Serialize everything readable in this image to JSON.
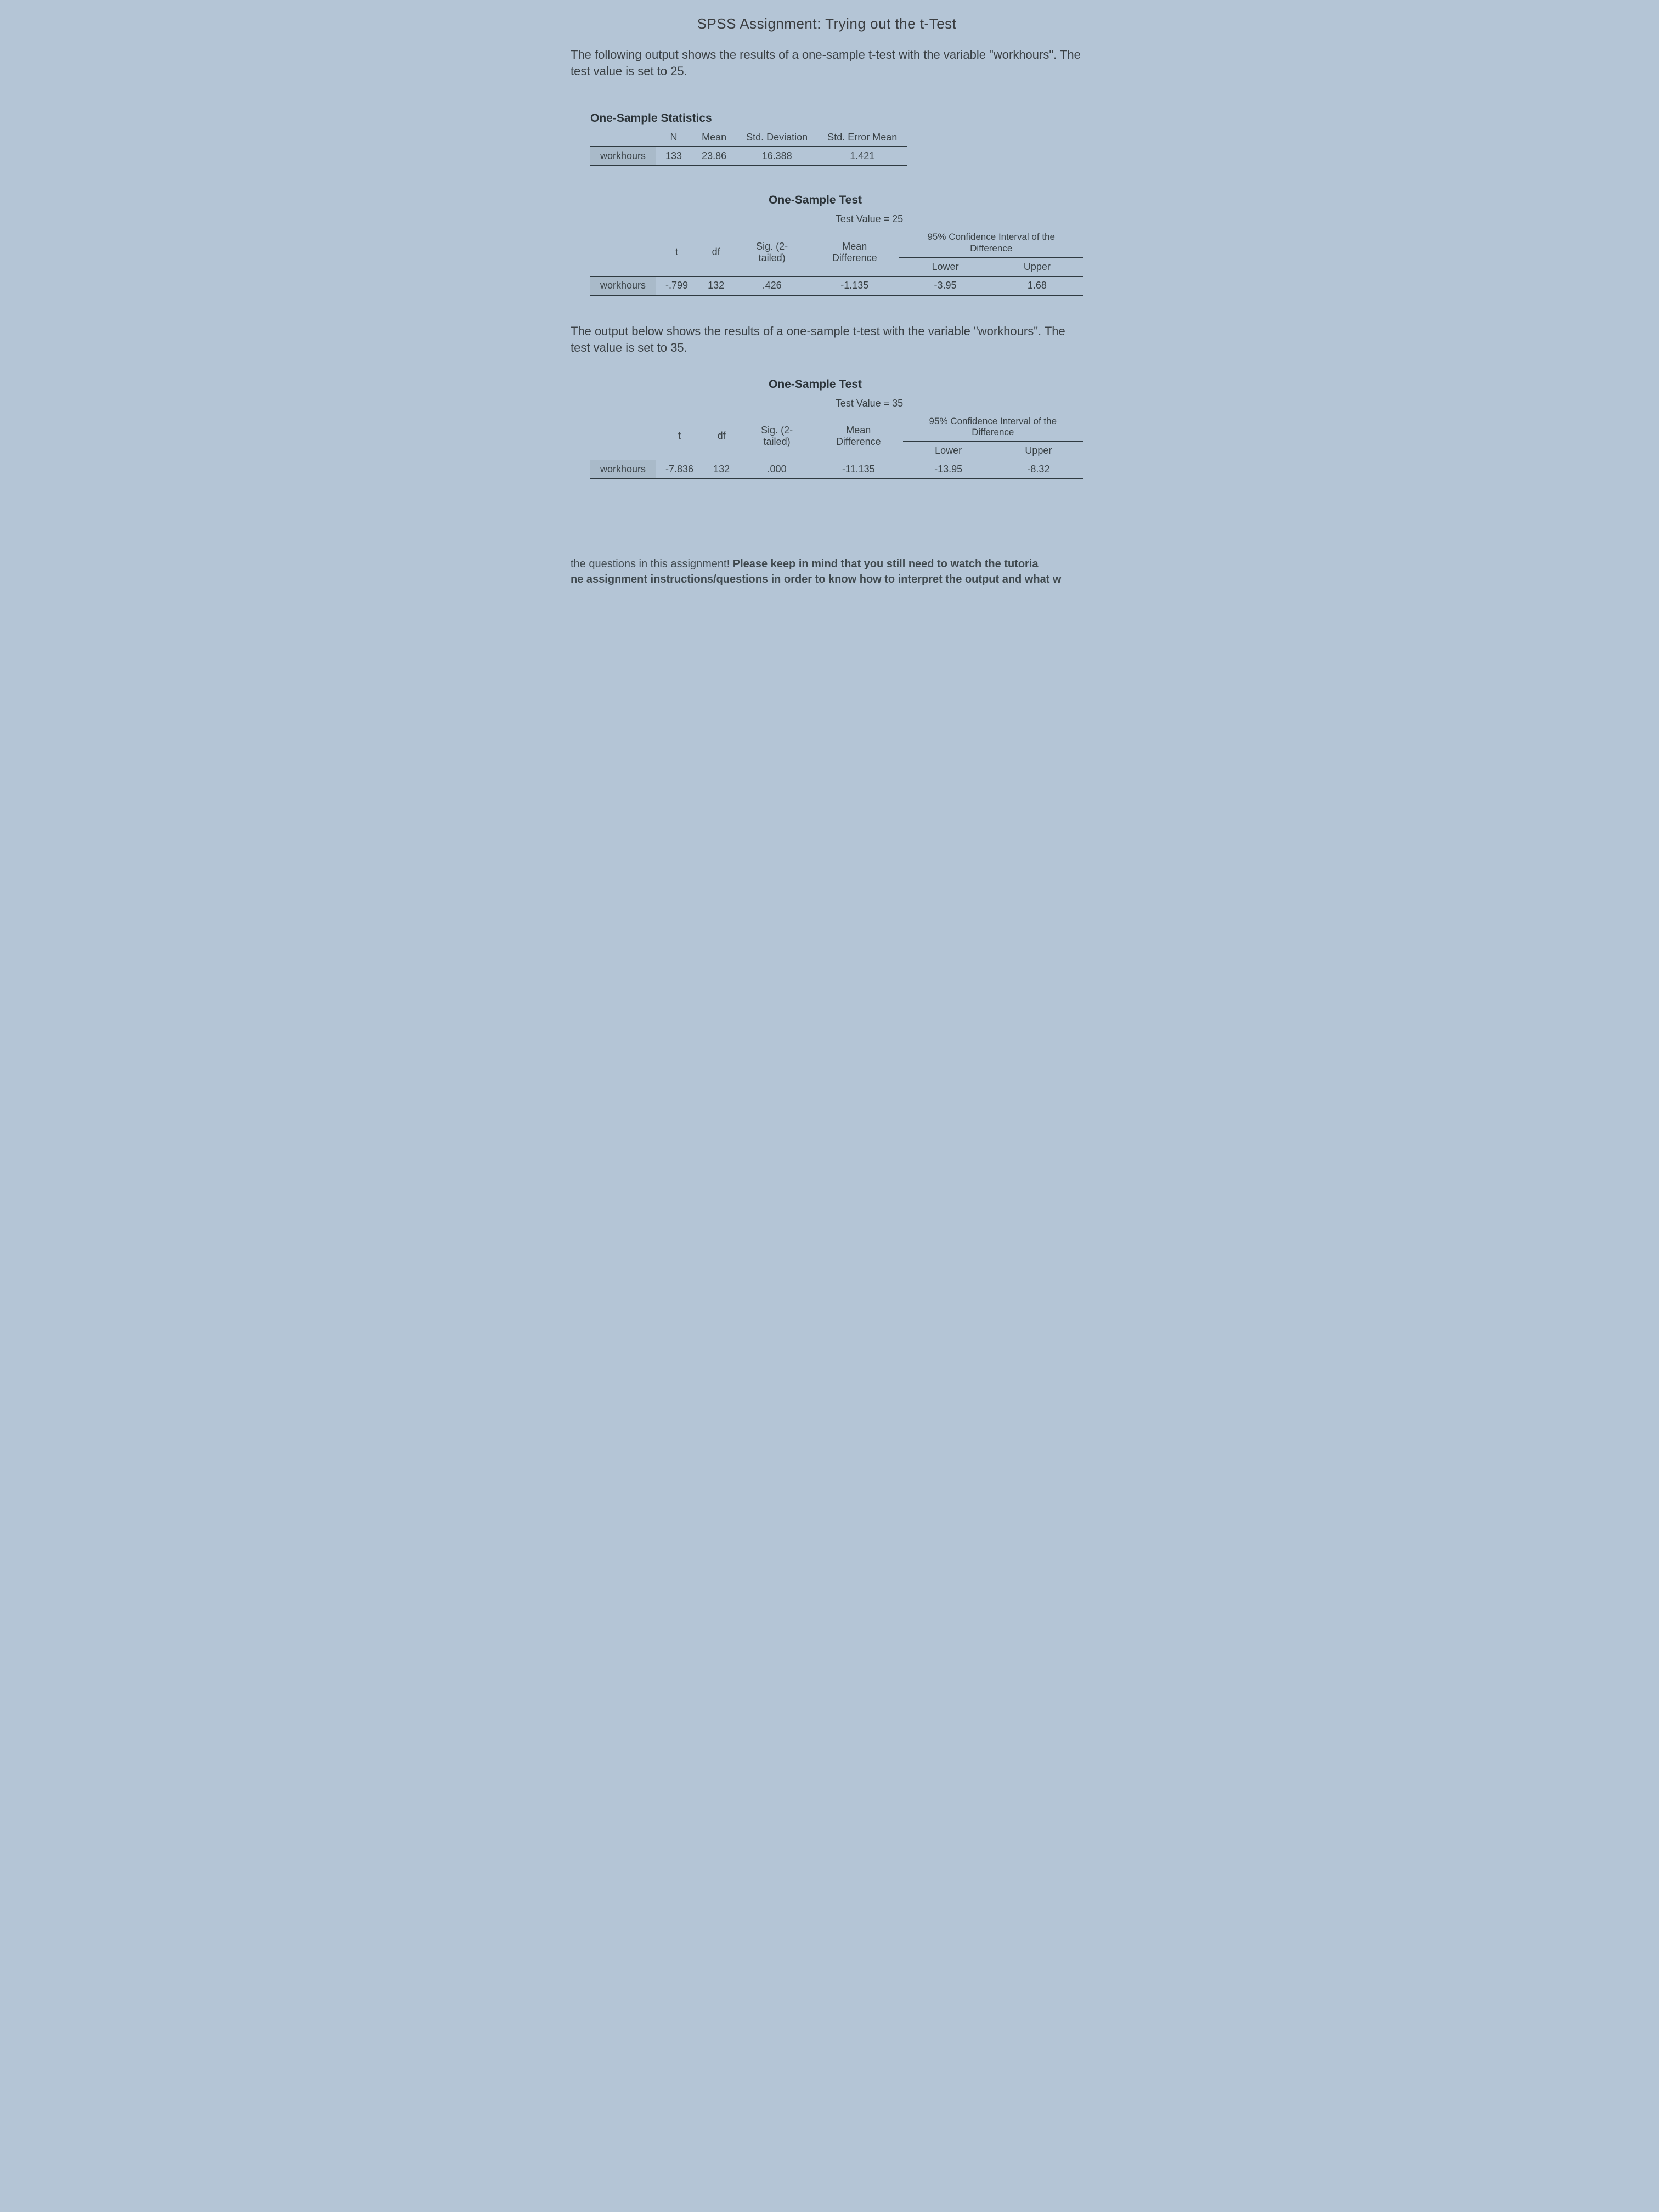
{
  "title": "SPSS Assignment: Trying out the t-Test",
  "intro1": "The following output shows the results of a one-sample t-test with the variable \"workhours\". The test value is set to 25.",
  "intro2": "The output below shows the results of a one-sample t-test with the variable \"workhours\". The test value is set to 35.",
  "stats_table": {
    "title": "One-Sample Statistics",
    "headers": {
      "n": "N",
      "mean": "Mean",
      "sd": "Std. Deviation",
      "sem": "Std. Error Mean"
    },
    "row_label": "workhours",
    "row": {
      "n": "133",
      "mean": "23.86",
      "sd": "16.388",
      "sem": "1.421"
    }
  },
  "test25": {
    "title": "One-Sample Test",
    "test_value_label": "Test Value = 25",
    "headers": {
      "t": "t",
      "df": "df",
      "sig": "Sig. (2-tailed)",
      "meandiff": "Mean Difference",
      "ci": "95% Confidence Interval of the Difference",
      "lower": "Lower",
      "upper": "Upper"
    },
    "row_label": "workhours",
    "row": {
      "t": "-.799",
      "df": "132",
      "sig": ".426",
      "meandiff": "-1.135",
      "lower": "-3.95",
      "upper": "1.68"
    }
  },
  "test35": {
    "title": "One-Sample Test",
    "test_value_label": "Test Value = 35",
    "headers": {
      "t": "t",
      "df": "df",
      "sig": "Sig. (2-tailed)",
      "meandiff": "Mean Difference",
      "ci": "95% Confidence Interval of the Difference",
      "lower": "Lower",
      "upper": "Upper"
    },
    "row_label": "workhours",
    "row": {
      "t": "-7.836",
      "df": "132",
      "sig": ".000",
      "meandiff": "-11.135",
      "lower": "-13.95",
      "upper": "-8.32"
    }
  },
  "footnote_plain": "the questions in this assignment!  ",
  "footnote_bold": "Please keep in mind that you still need to watch the tutoria",
  "footnote_bold2": "ne assignment instructions/questions in order to know how to interpret the output and what w"
}
